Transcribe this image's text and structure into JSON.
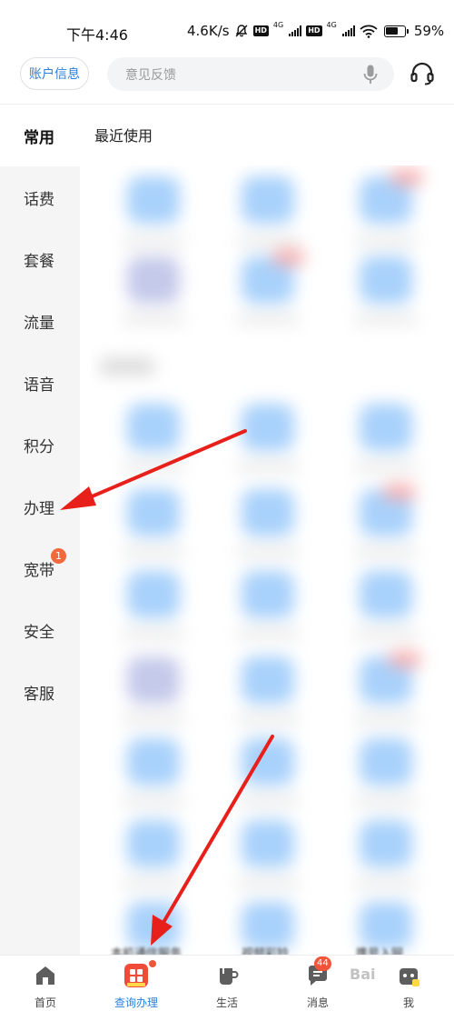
{
  "status_bar": {
    "time": "下午4:46",
    "speed": "4.6K/s",
    "hd1": "HD",
    "net1": "4G",
    "hd2": "HD",
    "net2": "4G",
    "battery": "59%"
  },
  "header": {
    "account_button": "账户信息",
    "search_placeholder": "意见反馈"
  },
  "sidebar": {
    "items": [
      {
        "label": "常用"
      },
      {
        "label": "话费"
      },
      {
        "label": "套餐"
      },
      {
        "label": "流量"
      },
      {
        "label": "语音"
      },
      {
        "label": "积分"
      },
      {
        "label": "办理"
      },
      {
        "label": "宽带",
        "badge": "1"
      },
      {
        "label": "安全"
      },
      {
        "label": "客服"
      }
    ]
  },
  "content": {
    "section_title": "最近使用",
    "bottom_labels": [
      "本机通信服务",
      "视频彩铃",
      "携号入网"
    ]
  },
  "bottom_nav": {
    "items": [
      {
        "label": "首页"
      },
      {
        "label": "查询办理"
      },
      {
        "label": "生活"
      },
      {
        "label": "消息",
        "badge": "44"
      },
      {
        "label": "我"
      }
    ]
  },
  "watermark": "Bai"
}
